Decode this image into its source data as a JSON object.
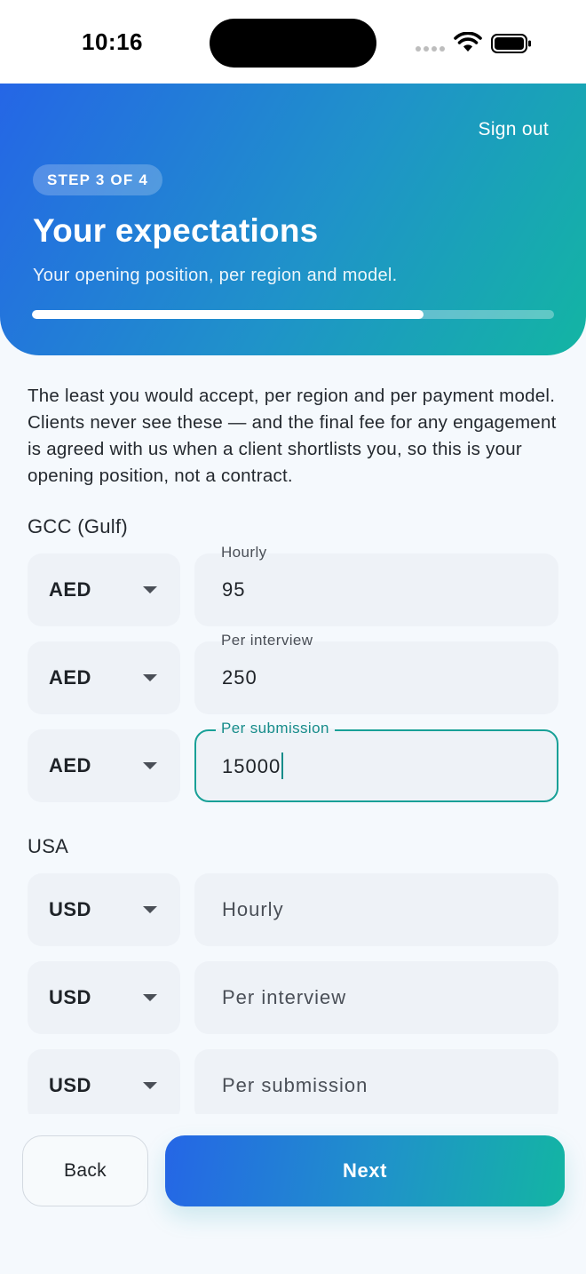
{
  "status_bar": {
    "time": "10:16"
  },
  "header": {
    "sign_out": "Sign out",
    "step": "STEP 3 OF 4",
    "title": "Your expectations",
    "subtitle": "Your opening position, per region and model.",
    "progress_percent": 75
  },
  "intro": "The least you would accept, per region and per payment model. Clients never see these — and the final fee for any engagement is agreed with us when a client shortlists you, so this is your opening position, not a contract.",
  "regions": [
    {
      "label": "GCC (Gulf)",
      "rows": [
        {
          "currency": "AED",
          "label": "Hourly",
          "value": "95"
        },
        {
          "currency": "AED",
          "label": "Per interview",
          "value": "250"
        },
        {
          "currency": "AED",
          "label": "Per submission",
          "value": "15000"
        }
      ]
    },
    {
      "label": "USA",
      "rows": [
        {
          "currency": "USD",
          "placeholder": "Hourly"
        },
        {
          "currency": "USD",
          "placeholder": "Per interview"
        },
        {
          "currency": "USD",
          "placeholder": "Per submission"
        }
      ]
    }
  ],
  "buttons": {
    "back": "Back",
    "next": "Next"
  },
  "colors": {
    "accent_start": "#2566e6",
    "accent_end": "#13b5a3",
    "focus": "#18a097"
  }
}
